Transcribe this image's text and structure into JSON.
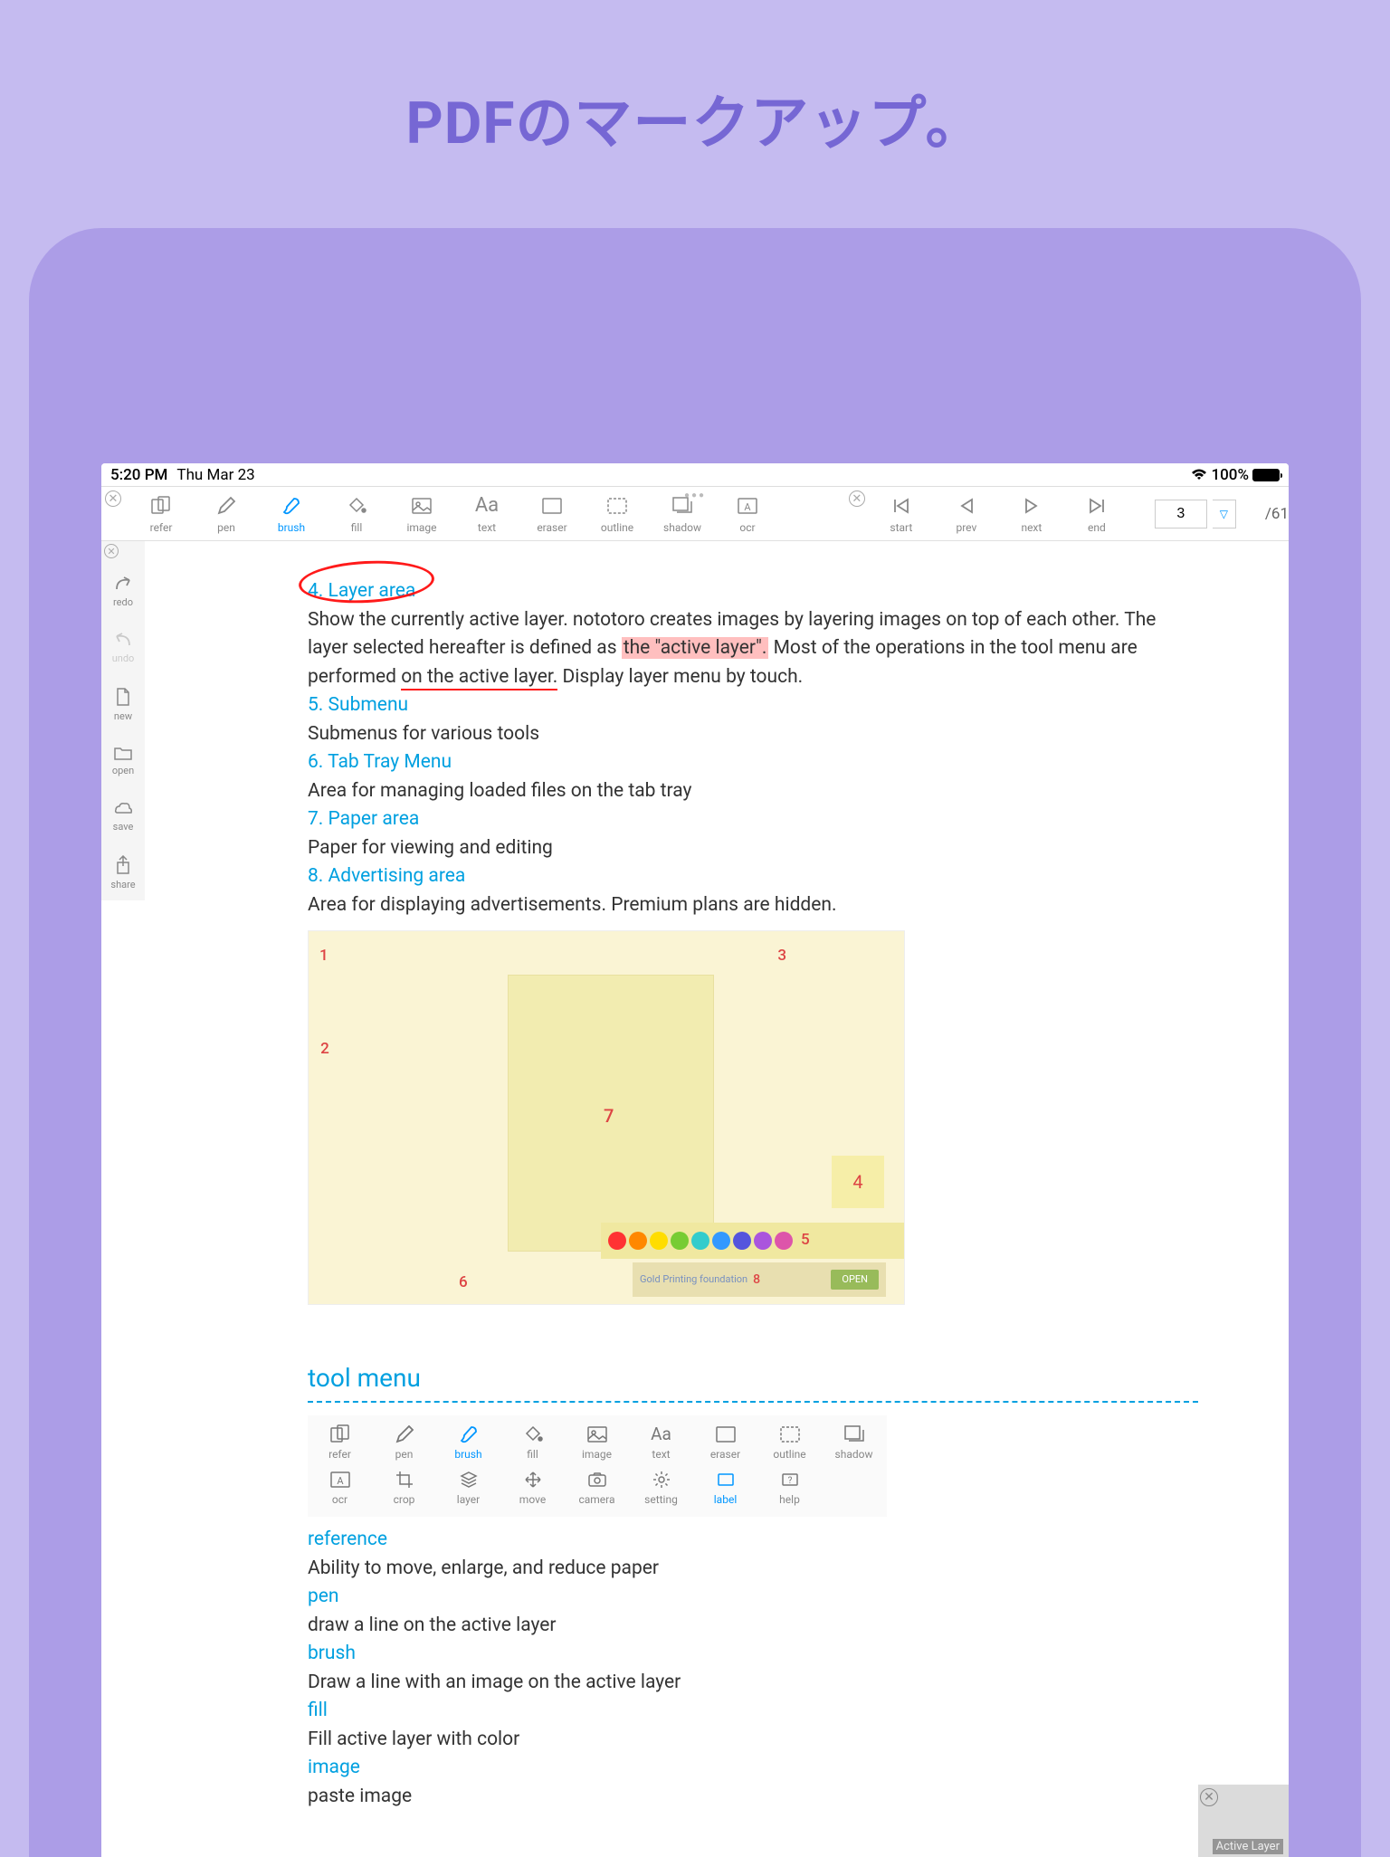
{
  "page_title": "PDFのマークアップ。",
  "status": {
    "time": "5:20 PM",
    "date": "Thu Mar 23",
    "battery": "100%"
  },
  "toolbar": {
    "left": [
      {
        "id": "refer",
        "label": "refer"
      },
      {
        "id": "pen",
        "label": "pen"
      },
      {
        "id": "brush",
        "label": "brush",
        "active": true
      },
      {
        "id": "fill",
        "label": "fill"
      },
      {
        "id": "image",
        "label": "image"
      },
      {
        "id": "text",
        "label": "text",
        "icon": "Aa"
      },
      {
        "id": "eraser",
        "label": "eraser"
      },
      {
        "id": "outline",
        "label": "outline"
      },
      {
        "id": "shadow",
        "label": "shadow"
      },
      {
        "id": "ocr",
        "label": "ocr"
      }
    ],
    "right": [
      {
        "id": "start",
        "label": "start"
      },
      {
        "id": "prev",
        "label": "prev"
      },
      {
        "id": "next",
        "label": "next"
      },
      {
        "id": "end",
        "label": "end"
      }
    ],
    "page_number": "3",
    "page_total": "/61"
  },
  "sidebar": [
    {
      "id": "redo",
      "label": "redo"
    },
    {
      "id": "undo",
      "label": "undo",
      "disabled": true
    },
    {
      "id": "new",
      "label": "new"
    },
    {
      "id": "open",
      "label": "open"
    },
    {
      "id": "save",
      "label": "save"
    },
    {
      "id": "share",
      "label": "share"
    }
  ],
  "doc": {
    "s4_title": "4. Layer area",
    "s4_body_a": "Show the currently active layer. nototoro creates images by layering images on top of each other. The layer selected hereafter is defined as ",
    "s4_hl": "the \"active layer\".",
    "s4_body_b": " Most of the operations in the tool menu are performed ",
    "s4_ul": "on the active layer.",
    "s4_body_c": " Display layer menu by touch.",
    "s5_title": "5. Submenu",
    "s5_body": "Submenus for various tools",
    "s6_title": "6. Tab Tray Menu",
    "s6_body": "Area for managing loaded files on the tab tray",
    "s7_title": "7. Paper area",
    "s7_body": "Paper for viewing and editing",
    "s8_title": "8. Advertising area",
    "s8_body": "Area for displaying advertisements. Premium plans are hidden.",
    "shot": {
      "n1": "1",
      "n2": "2",
      "n3": "3",
      "n4": "4",
      "n5": "5",
      "n6": "6",
      "n7": "7",
      "n8": "8",
      "ad_text": "Gold Printing foundation",
      "open": "OPEN"
    },
    "tool_menu_header": "tool menu",
    "menu_row1": [
      {
        "label": "refer"
      },
      {
        "label": "pen"
      },
      {
        "label": "brush",
        "active": true
      },
      {
        "label": "fill"
      },
      {
        "label": "image"
      },
      {
        "label": "text",
        "icon": "Aa"
      },
      {
        "label": "eraser"
      },
      {
        "label": "outline"
      },
      {
        "label": "shadow"
      }
    ],
    "menu_row2": [
      {
        "label": "ocr"
      },
      {
        "label": "crop"
      },
      {
        "label": "layer"
      },
      {
        "label": "move"
      },
      {
        "label": "camera"
      },
      {
        "label": "setting"
      },
      {
        "label": "label",
        "active": true
      },
      {
        "label": "help"
      }
    ],
    "defs": [
      {
        "term": "reference",
        "body": "Ability to move, enlarge, and reduce paper"
      },
      {
        "term": "pen",
        "body": "draw a line on the active layer"
      },
      {
        "term": "brush",
        "body": "Draw a line with an image on the active layer"
      },
      {
        "term": "fill",
        "body": "Fill active layer with color"
      },
      {
        "term": "image",
        "body": "paste image"
      }
    ]
  },
  "footer": {
    "label": "Active Layer"
  }
}
